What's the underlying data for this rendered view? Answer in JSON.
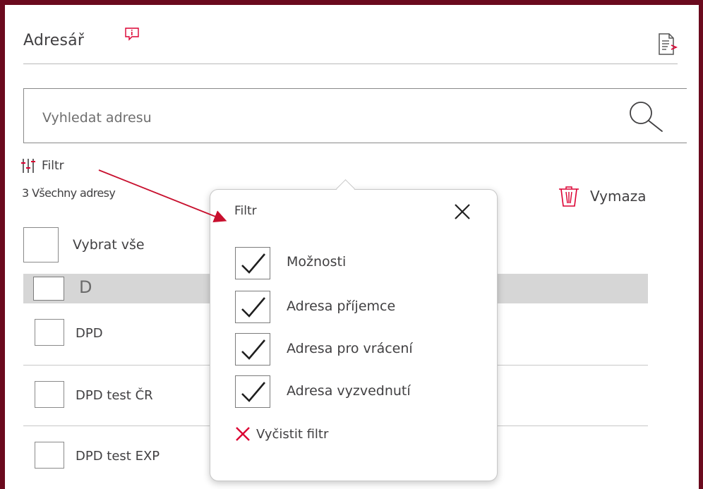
{
  "header": {
    "title": "Adresář"
  },
  "search": {
    "placeholder": "Vyhledat adresu"
  },
  "toolbar": {
    "filter_label": "Filtr",
    "count_label": "3 Všechny adresy",
    "delete_label": "Vymaza"
  },
  "list": {
    "select_all_label": "Vybrat vše",
    "group_letter": "D",
    "rows": [
      {
        "label": "DPD"
      },
      {
        "label": "DPD test ČR"
      },
      {
        "label": "DPD test EXP"
      }
    ]
  },
  "filter_popup": {
    "title": "Filtr",
    "options": [
      {
        "label": "Možnosti",
        "checked": true
      },
      {
        "label": "Adresa příjemce",
        "checked": true
      },
      {
        "label": "Adresa pro vrácení",
        "checked": true
      },
      {
        "label": "Adresa vyzvednutí",
        "checked": true
      }
    ],
    "clear_label": "Vyčistit filtr"
  },
  "colors": {
    "frame": "#6b0a1e",
    "accent": "#dc0032",
    "arrow": "#c8102e",
    "text": "#414042",
    "group_header_bg": "#d6d6d6"
  },
  "icons": [
    "info-icon",
    "export-icon",
    "search-icon",
    "filter-sliders-icon",
    "trash-icon",
    "close-icon",
    "checkmark-icon",
    "clear-x-icon"
  ]
}
